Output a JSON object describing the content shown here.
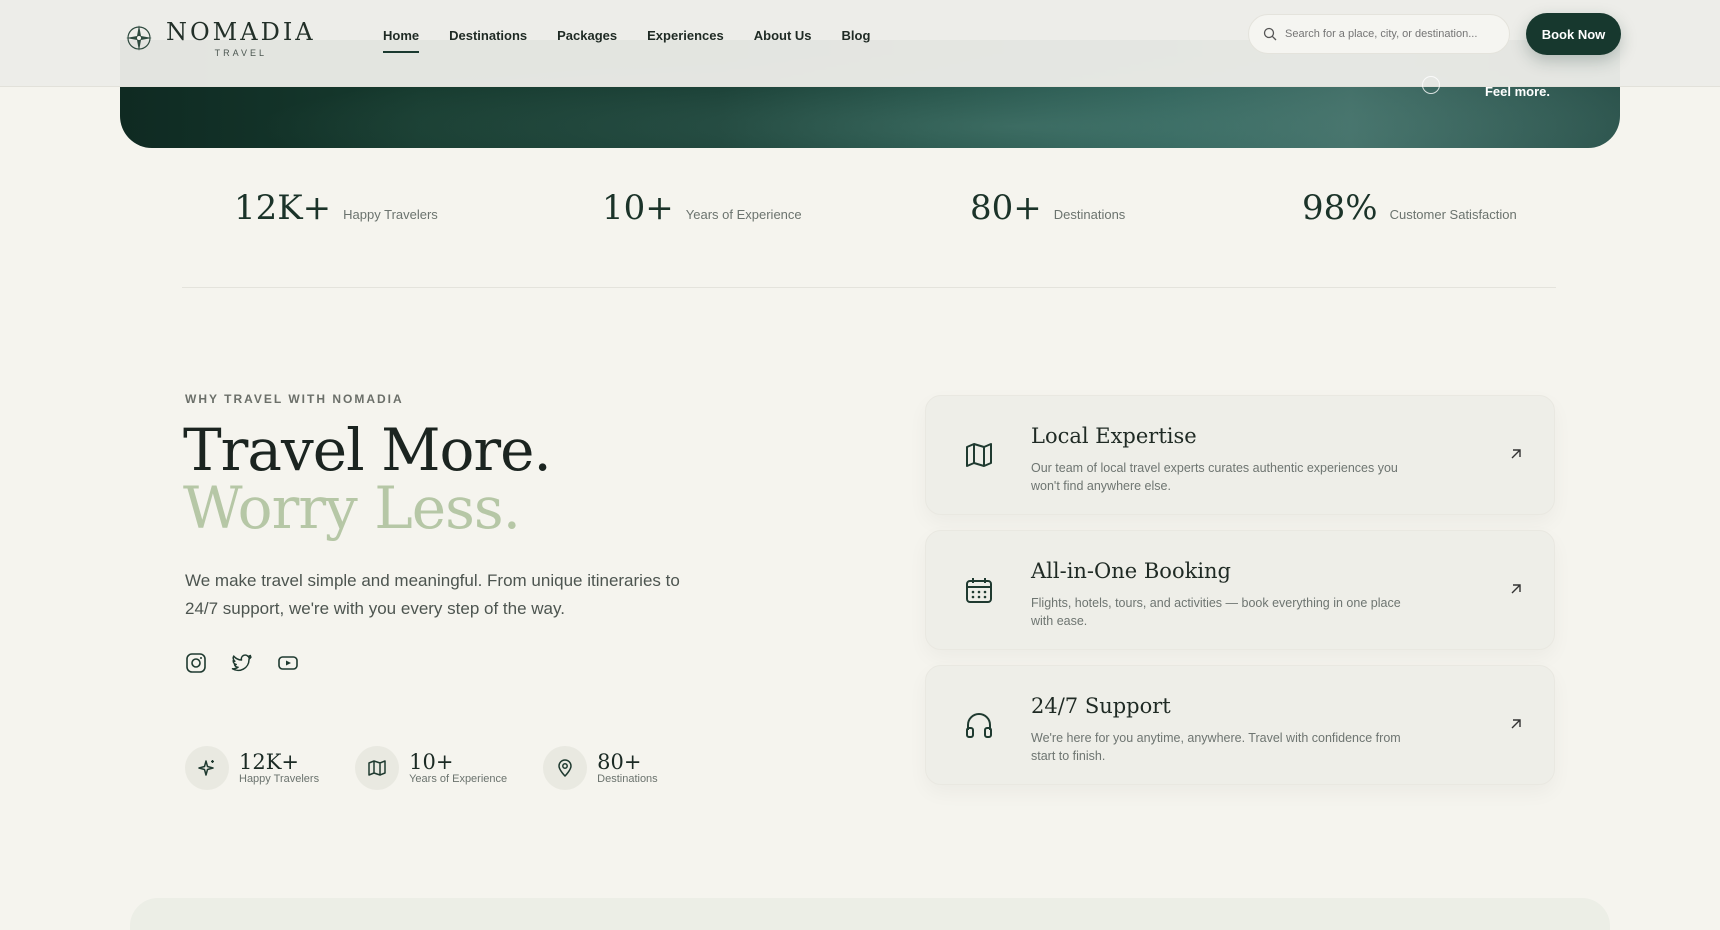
{
  "brand": {
    "name": "NOMADIA",
    "sub": "TRAVEL"
  },
  "nav": {
    "items": [
      {
        "label": "Home",
        "active": true
      },
      {
        "label": "Destinations"
      },
      {
        "label": "Packages"
      },
      {
        "label": "Experiences"
      },
      {
        "label": "About Us"
      },
      {
        "label": "Blog"
      }
    ],
    "search_placeholder": "Search for a place, city, or destination...",
    "book_label": "Book Now"
  },
  "hero": {
    "cta": "Feel more."
  },
  "stats": [
    {
      "value": "12K+",
      "label": "Happy Travelers"
    },
    {
      "value": "10+",
      "label": "Years of Experience"
    },
    {
      "value": "80+",
      "label": "Destinations"
    },
    {
      "value": "98%",
      "label": "Customer Satisfaction"
    }
  ],
  "why": {
    "eyebrow": "WHY TRAVEL WITH NOMADIA",
    "headline1": "Travel More.",
    "headline2": "Worry Less.",
    "intro": "We make travel simple and meaningful. From unique itineraries to 24/7 support, we're with you every step of the way.",
    "social": [
      "instagram-icon",
      "twitter-icon",
      "youtube-icon"
    ],
    "mini_stats": [
      {
        "value": "12K+",
        "label": "Happy Travelers",
        "icon": "sparkle-icon"
      },
      {
        "value": "10+",
        "label": "Years of Experience",
        "icon": "map-icon"
      },
      {
        "value": "80+",
        "label": "Destinations",
        "icon": "pin-icon"
      }
    ]
  },
  "features": [
    {
      "title": "Local Expertise",
      "desc": "Our team of local travel experts curates authentic experiences you won't find anywhere else.",
      "icon": "map-icon"
    },
    {
      "title": "All-in-One Booking",
      "desc": "Flights, hotels, tours, and activities — book everything in one place with ease.",
      "icon": "calendar-icon"
    },
    {
      "title": "24/7 Support",
      "desc": "We're here for you anytime, anywhere. Travel with confidence from start to finish.",
      "icon": "headphones-icon"
    }
  ],
  "colors": {
    "accent": "#17382e",
    "soft_green": "#b6c7a6",
    "background": "#f5f4ee"
  }
}
